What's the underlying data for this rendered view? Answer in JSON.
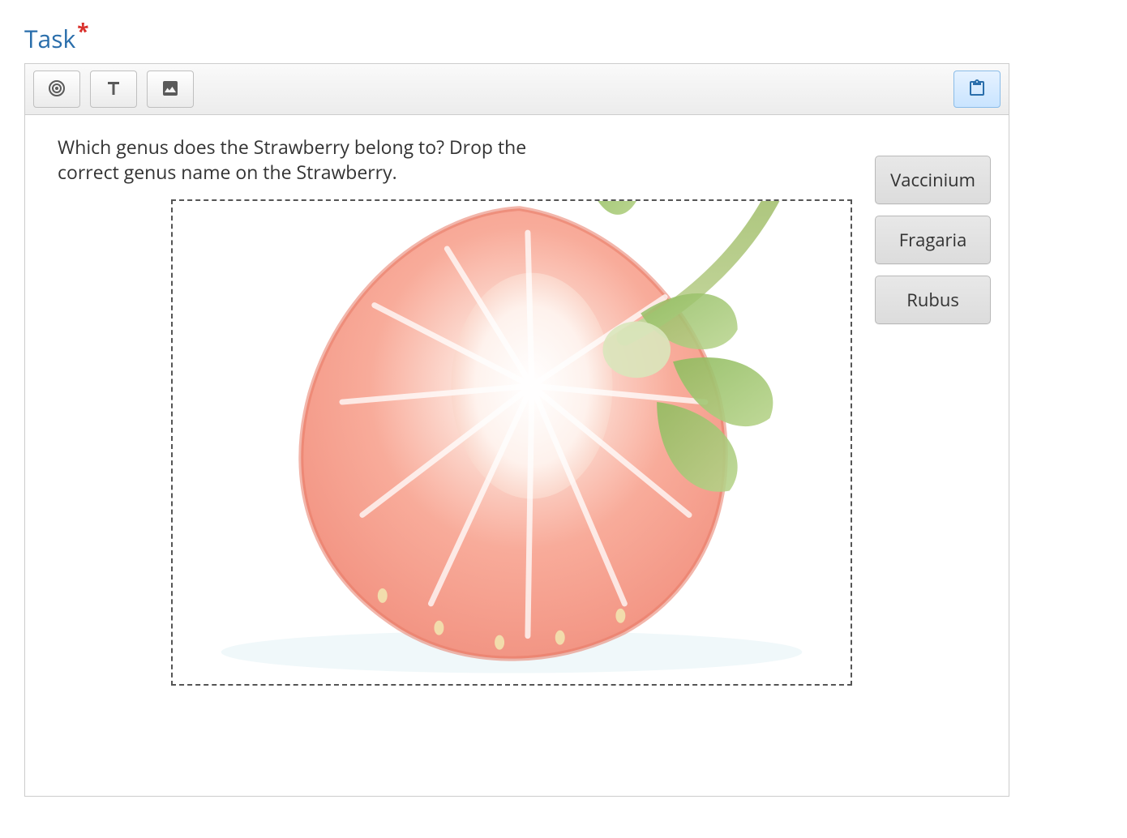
{
  "header": {
    "title": "Task",
    "required_marker": "*"
  },
  "toolbar": {
    "icons": {
      "target": "target-icon",
      "text": "text-icon",
      "image": "image-icon",
      "clipboard": "clipboard-icon"
    }
  },
  "question": {
    "prompt": "Which genus does the Strawberry belong to? Drop the correct genus name on the Strawberry."
  },
  "drop_zone": {
    "image_description": "strawberry-cross-section"
  },
  "drag_items": [
    {
      "label": "Vaccinium"
    },
    {
      "label": "Fragaria"
    },
    {
      "label": "Rubus"
    }
  ]
}
